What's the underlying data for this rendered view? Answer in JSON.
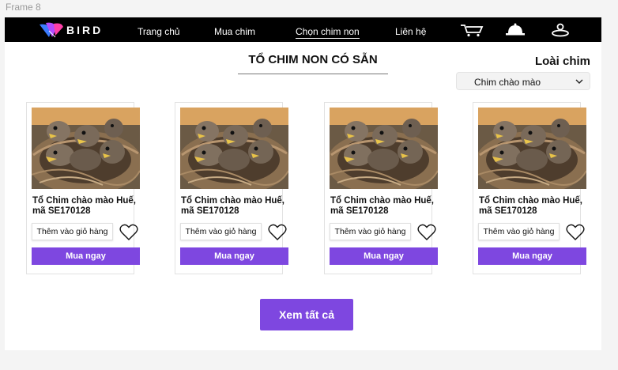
{
  "frame_label": "Frame 8",
  "header": {
    "logo_text": "BIRD",
    "nav": [
      "Trang chủ",
      "Mua chim",
      "Chọn chim non",
      "Liên hệ"
    ],
    "icons": [
      "cart-icon",
      "bell-icon",
      "user-icon"
    ]
  },
  "section": {
    "title": "TỔ CHIM NON CÓ SẴN"
  },
  "filter": {
    "label": "Loài chim",
    "selected": "Chim chào mào"
  },
  "products": [
    {
      "title": "Tổ Chim chào mào Huế, mã SE170128",
      "cart_label": "Thêm vào giỏ hàng",
      "buy_label": "Mua ngay"
    },
    {
      "title": "Tổ Chim chào mào Huế, mã SE170128",
      "cart_label": "Thêm vào giỏ hàng",
      "buy_label": "Mua ngay"
    },
    {
      "title": "Tổ Chim chào mào Huế, mã SE170128",
      "cart_label": "Thêm vào giỏ hàng",
      "buy_label": "Mua ngay"
    },
    {
      "title": "Tổ Chim chào mào Huế, mã SE170128",
      "cart_label": "Thêm vào giỏ hàng",
      "buy_label": "Mua ngay"
    }
  ],
  "view_all_label": "Xem tất cả",
  "colors": {
    "accent": "#7e47e0",
    "navbar": "#000000",
    "page_bg": "#f4f4f4"
  }
}
